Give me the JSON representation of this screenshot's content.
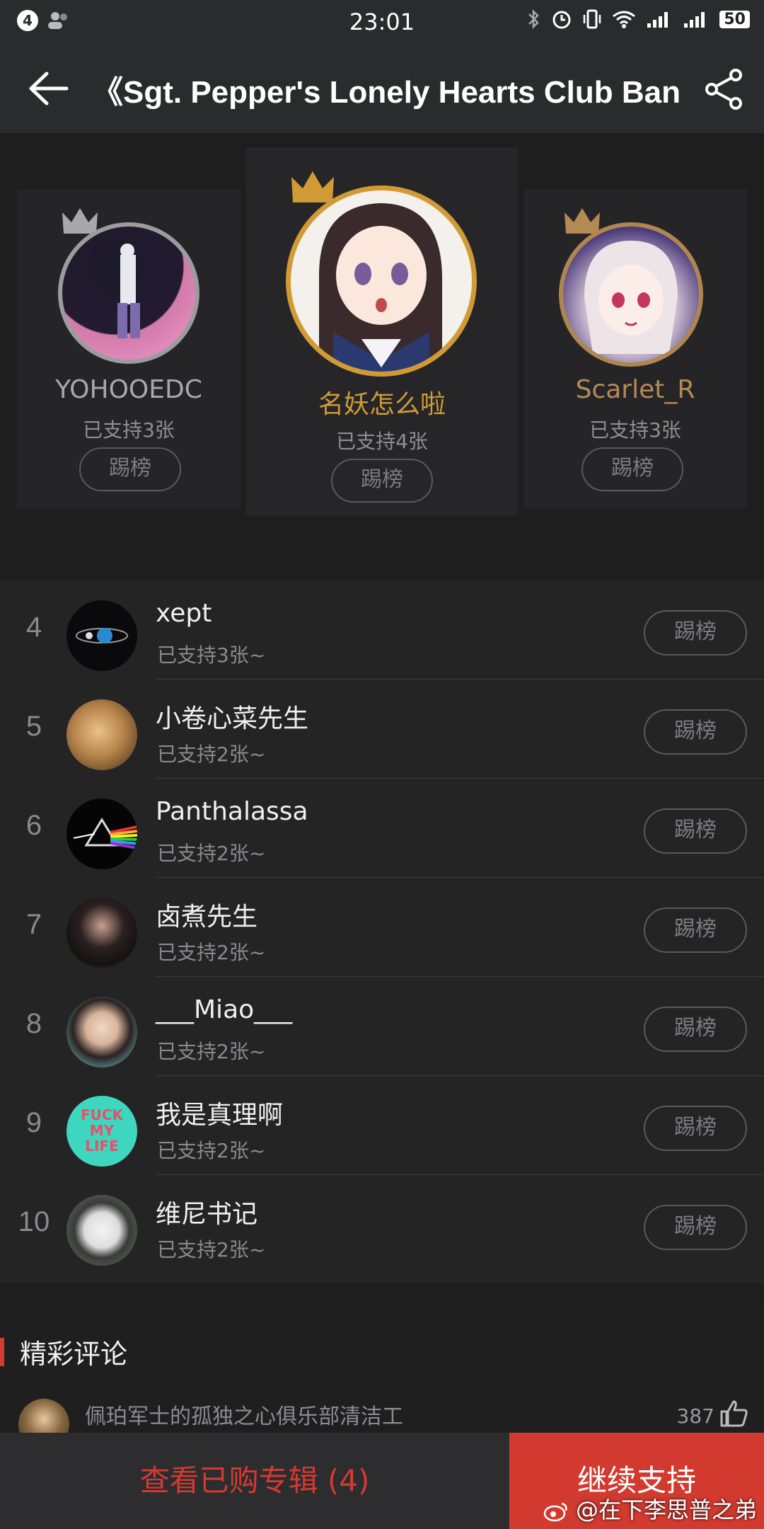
{
  "status_bar": {
    "notification_count": "4",
    "time": "23:01",
    "battery": "50"
  },
  "header": {
    "title": "《Sgt. Pepper's Lonely Hearts Club Band (I",
    "back_icon": "arrow-left-icon",
    "share_icon": "share-icon"
  },
  "podium": [
    {
      "name": "名妖怎么啦",
      "info": "已支持4张",
      "kick": "踢榜",
      "crown": "gold",
      "name_color": "#d19a35",
      "ring": "#d19a35"
    },
    {
      "name": "YOHOOEDC",
      "info": "已支持3张",
      "kick": "踢榜",
      "crown": "silver",
      "name_color": "#a8a8ab",
      "ring": "#9c9c9f"
    },
    {
      "name": "Scarlet_R",
      "info": "已支持3张",
      "kick": "踢榜",
      "crown": "bronze",
      "name_color": "#b48a54",
      "ring": "#b08650"
    }
  ],
  "ranking": [
    {
      "rank": "4",
      "name": "xept",
      "info": "已支持3张~",
      "kick": "踢榜"
    },
    {
      "rank": "5",
      "name": "小卷心菜先生",
      "info": "已支持2张~",
      "kick": "踢榜"
    },
    {
      "rank": "6",
      "name": "Panthalassa",
      "info": "已支持2张~",
      "kick": "踢榜"
    },
    {
      "rank": "7",
      "name": "卤煮先生",
      "info": "已支持2张~",
      "kick": "踢榜"
    },
    {
      "rank": "8",
      "name": "___Miao___",
      "info": "已支持2张~",
      "kick": "踢榜"
    },
    {
      "rank": "9",
      "name": "我是真理啊",
      "info": "已支持2张~",
      "kick": "踢榜"
    },
    {
      "rank": "10",
      "name": "维尼书记",
      "info": "已支持2张~",
      "kick": "踢榜"
    }
  ],
  "comments": {
    "title": "精彩评论",
    "first": {
      "text": "佩珀军士的孤独之心俱乐部清洁工",
      "likes": "387"
    }
  },
  "bottom": {
    "purchased": "查看已购专辑 (4)",
    "support": "继续支持"
  },
  "watermark": "@在下李思普之弟",
  "colors": {
    "accent_red": "#d23a30",
    "gold": "#d19a35"
  }
}
